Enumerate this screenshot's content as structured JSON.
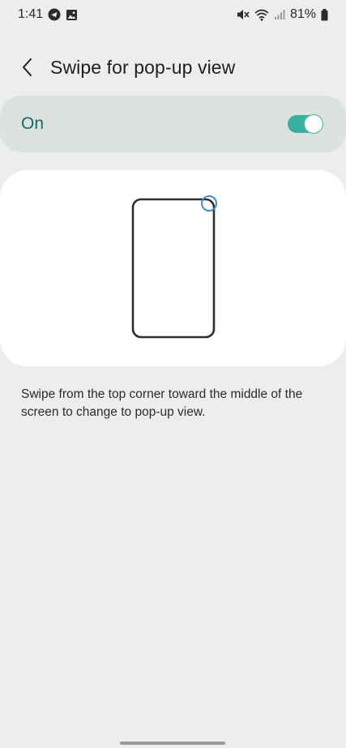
{
  "status_bar": {
    "time": "1:41",
    "battery": "81%",
    "left_icons": [
      "telegram-icon",
      "image-icon"
    ],
    "right_icons": [
      "mute-icon",
      "wifi-icon",
      "signal-icon",
      "battery-icon"
    ]
  },
  "header": {
    "title": "Swipe for pop-up view",
    "back_icon": "chevron-left-icon"
  },
  "toggle": {
    "label": "On",
    "state": true,
    "accent": "#3ab0a1",
    "label_color": "#0f6e63"
  },
  "illustration": {
    "icon": "phone-outline-icon",
    "touch_indicator": "corner-circle-icon",
    "accent": "#3a8fd0"
  },
  "description": "Swipe from the top corner toward the middle of the screen to change to pop-up view."
}
